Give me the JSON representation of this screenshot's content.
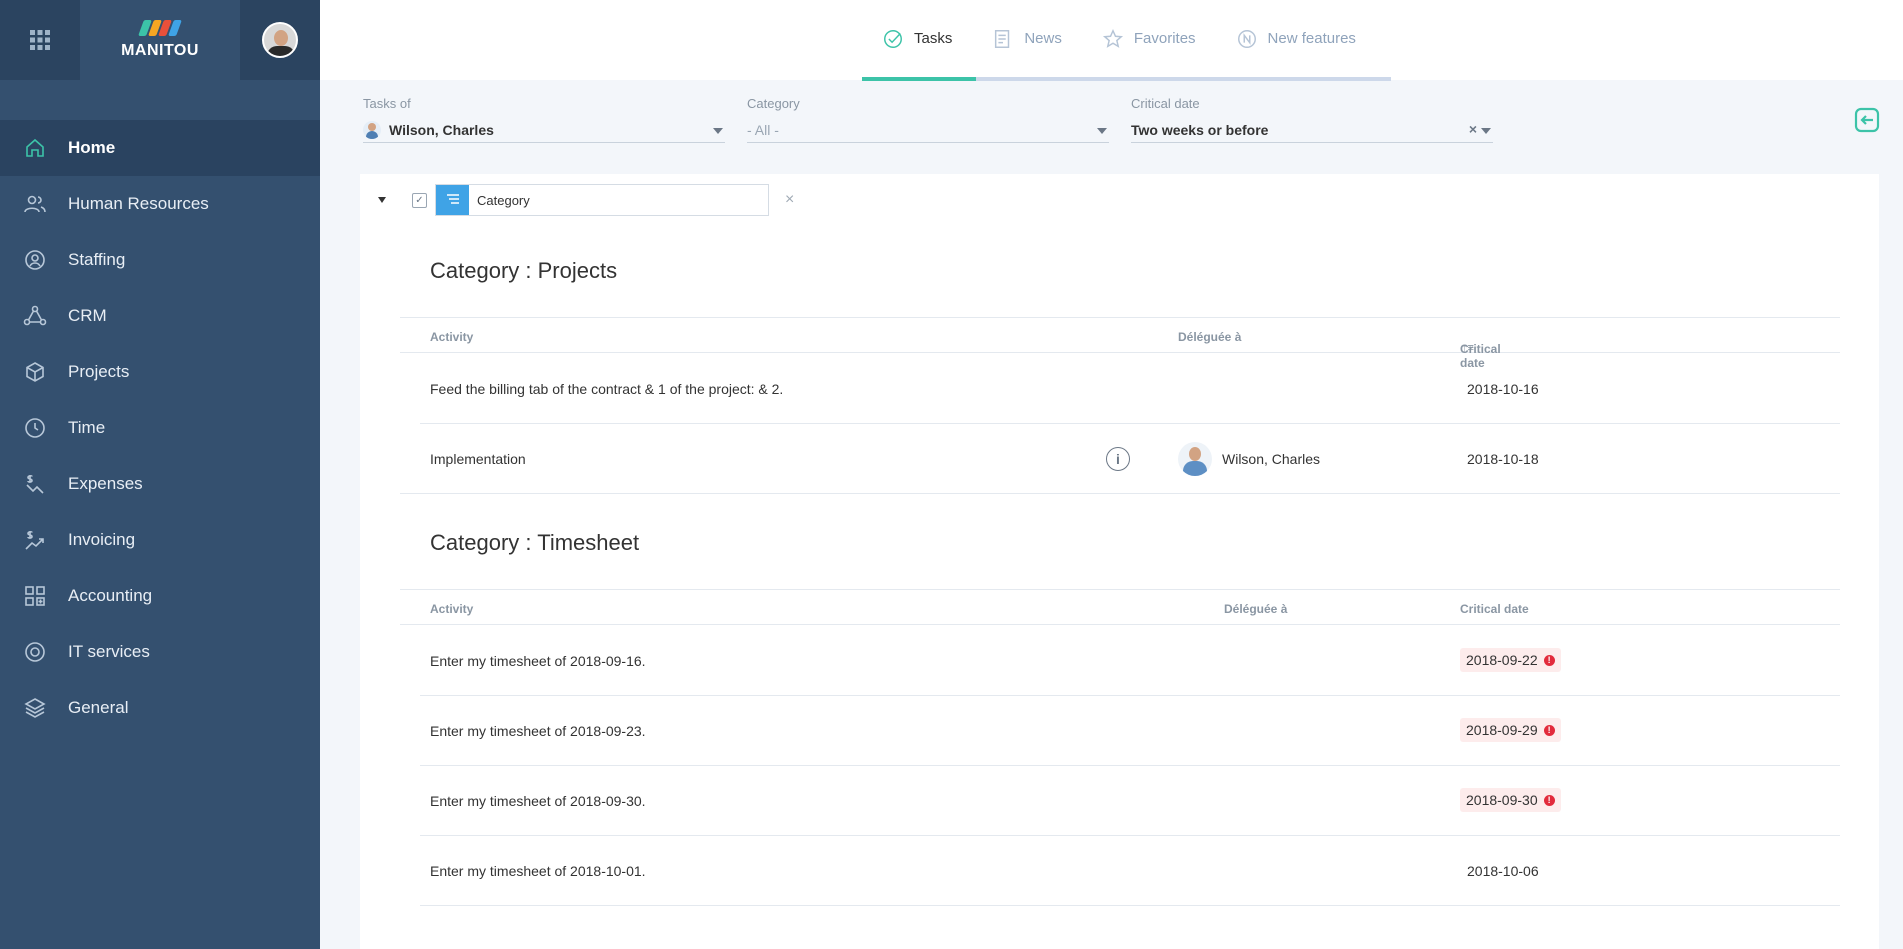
{
  "app": {
    "name": "MANITOU"
  },
  "sidebar": {
    "items": [
      {
        "label": "Home",
        "icon": "home-icon",
        "active": true
      },
      {
        "label": "Human Resources",
        "icon": "people-icon"
      },
      {
        "label": "Staffing",
        "icon": "staffing-icon"
      },
      {
        "label": "CRM",
        "icon": "crm-icon"
      },
      {
        "label": "Projects",
        "icon": "cube-icon"
      },
      {
        "label": "Time",
        "icon": "clock-icon"
      },
      {
        "label": "Expenses",
        "icon": "expenses-icon"
      },
      {
        "label": "Invoicing",
        "icon": "invoicing-icon"
      },
      {
        "label": "Accounting",
        "icon": "accounting-icon"
      },
      {
        "label": "IT services",
        "icon": "lifebuoy-icon"
      },
      {
        "label": "General",
        "icon": "layers-icon"
      }
    ]
  },
  "tabs": [
    {
      "label": "Tasks",
      "active": true
    },
    {
      "label": "News"
    },
    {
      "label": "Favorites"
    },
    {
      "label": "New features"
    }
  ],
  "filters": {
    "tasks_of": {
      "label": "Tasks of",
      "value": "Wilson, Charles"
    },
    "category": {
      "label": "Category",
      "value": "- All -"
    },
    "critical_date": {
      "label": "Critical date",
      "value": "Two weeks or before"
    }
  },
  "grouping": {
    "field": "Category"
  },
  "groups": [
    {
      "title": "Category : Projects",
      "headers": {
        "activity": "Activity",
        "delegated": "Déléguée à",
        "date": "Critical date"
      },
      "rows": [
        {
          "activity": "Feed the billing tab of the contract & 1 of the project: & 2.",
          "delegated": "",
          "date": "2018-10-16",
          "late": false
        },
        {
          "activity": "Implementation",
          "delegated": "Wilson, Charles",
          "date": "2018-10-18",
          "late": false
        }
      ]
    },
    {
      "title": "Category : Timesheet",
      "headers": {
        "activity": "Activity",
        "delegated": "Déléguée à",
        "date": "Critical date"
      },
      "rows": [
        {
          "activity": "Enter my timesheet of 2018-09-16.",
          "date": "2018-09-22",
          "late": true
        },
        {
          "activity": "Enter my timesheet of 2018-09-23.",
          "date": "2018-09-29",
          "late": true
        },
        {
          "activity": "Enter my timesheet of 2018-09-30.",
          "date": "2018-09-30",
          "late": true
        },
        {
          "activity": "Enter my timesheet of 2018-10-01.",
          "date": "2018-10-06",
          "late": false
        }
      ]
    }
  ],
  "colors": {
    "sidebar": "#34506f",
    "accent": "#3cc3a8",
    "blue": "#3fa3e6",
    "late": "#e22b3c"
  }
}
